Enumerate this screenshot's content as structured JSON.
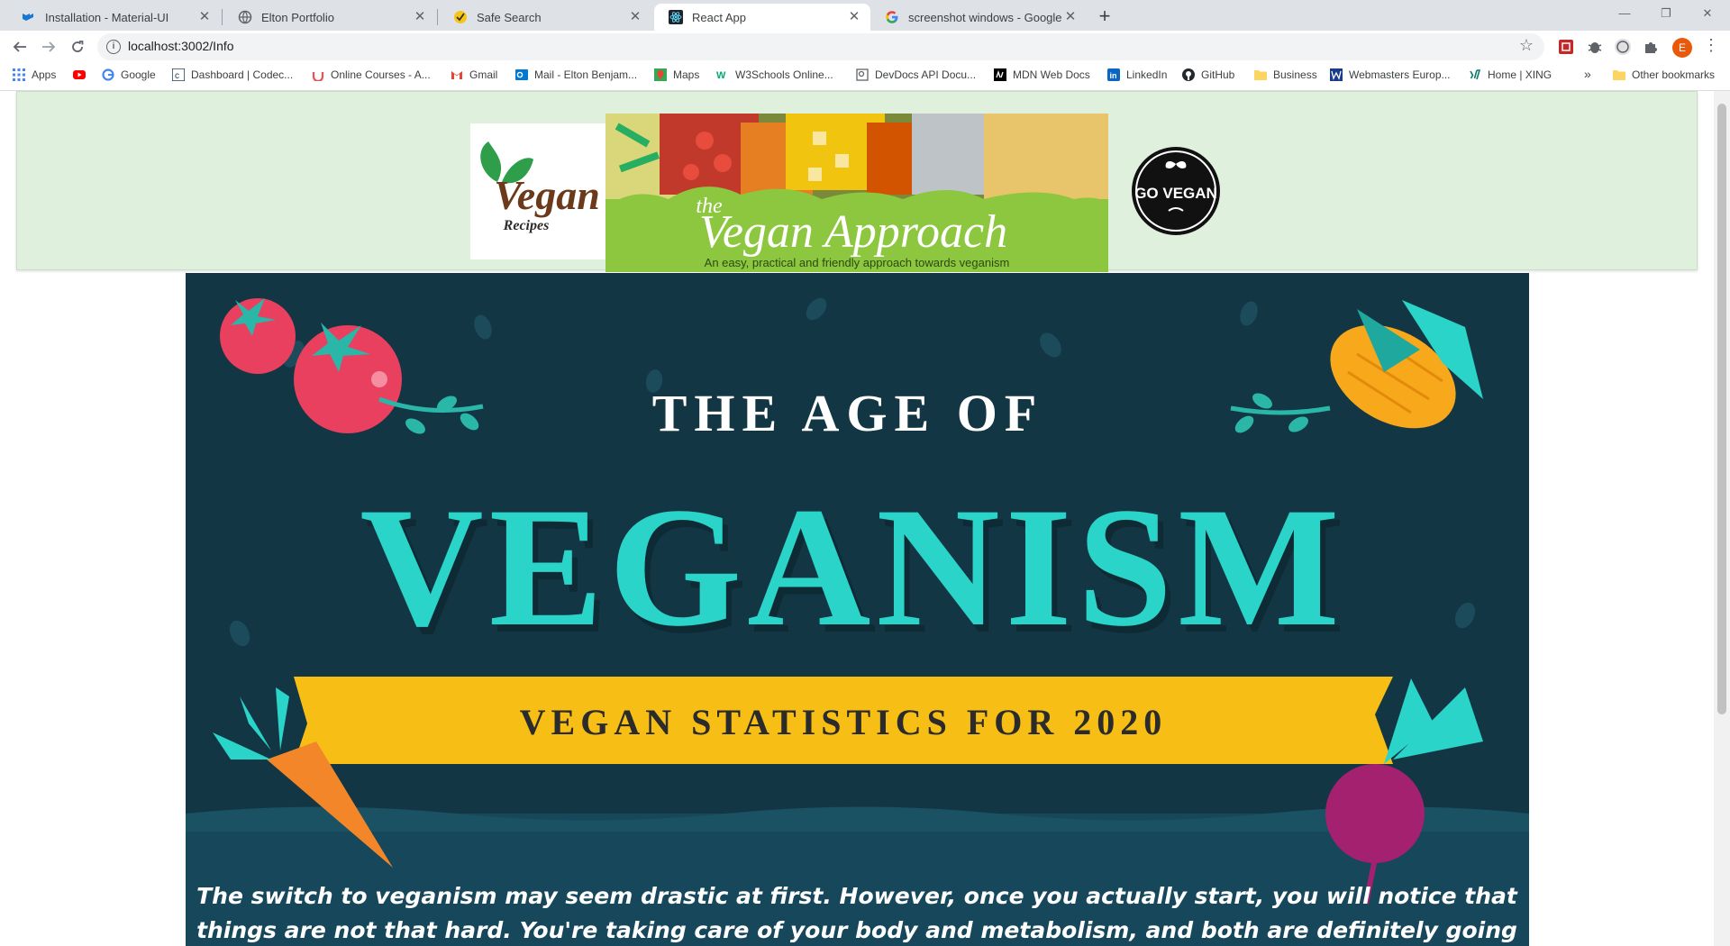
{
  "browser": {
    "tabs": [
      {
        "title": "Installation - Material-UI",
        "icon": "material-ui-icon",
        "active": false
      },
      {
        "title": "Elton Portfolio",
        "icon": "globe-icon",
        "active": false
      },
      {
        "title": "Safe Search",
        "icon": "check-badge-icon",
        "active": false
      },
      {
        "title": "React App",
        "icon": "react-icon",
        "active": true
      },
      {
        "title": "screenshot windows - Google Se",
        "icon": "google-icon",
        "active": false
      }
    ],
    "url": "localhost:3002/Info",
    "avatar_letter": "E",
    "bookmarks": [
      {
        "label": "Apps",
        "icon": "apps-grid-icon"
      },
      {
        "label": "",
        "icon": "youtube-icon"
      },
      {
        "label": "Google",
        "icon": "google-icon"
      },
      {
        "label": "Dashboard | Codec...",
        "icon": "codecademy-icon"
      },
      {
        "label": "Online Courses - A...",
        "icon": "udemy-icon"
      },
      {
        "label": "Gmail",
        "icon": "gmail-icon"
      },
      {
        "label": "Mail - Elton Benjam...",
        "icon": "outlook-icon"
      },
      {
        "label": "Maps",
        "icon": "maps-icon"
      },
      {
        "label": "W3Schools Online...",
        "icon": "w3schools-icon"
      },
      {
        "label": "DevDocs API Docu...",
        "icon": "devdocs-icon"
      },
      {
        "label": "MDN Web Docs",
        "icon": "mdn-icon"
      },
      {
        "label": "LinkedIn",
        "icon": "linkedin-icon"
      },
      {
        "label": "GitHub",
        "icon": "github-icon"
      },
      {
        "label": "Business",
        "icon": "folder-icon"
      },
      {
        "label": "Webmasters Europ...",
        "icon": "webmasters-icon"
      },
      {
        "label": "Home | XING",
        "icon": "xing-icon"
      }
    ],
    "overflow_label": "»",
    "other_bookmarks": "Other bookmarks"
  },
  "page": {
    "logo_left": {
      "line1": "Vegan",
      "line2": "Recipes"
    },
    "banner": {
      "small": "the",
      "title": "Vegan Approach",
      "tagline": "An easy, practical and friendly approach towards veganism"
    },
    "logo_right": "GO VEGAN",
    "infographic": {
      "heading_top": "THE AGE OF",
      "heading_main": "VEGANISM",
      "ribbon": "VEGAN STATISTICS FOR 2020",
      "body_line1": "The switch to veganism may seem drastic at first. However, once you actually start, you will notice that",
      "body_line2": "things are not that hard. You're taking care of your body and metabolism, and both are definitely going"
    }
  },
  "colors": {
    "header_bg": "#dff0dc",
    "banner_green": "#8dc63f",
    "infographic_bg": "#123644",
    "veganism_teal": "#2ad4c8",
    "ribbon_yellow": "#f7be16"
  }
}
